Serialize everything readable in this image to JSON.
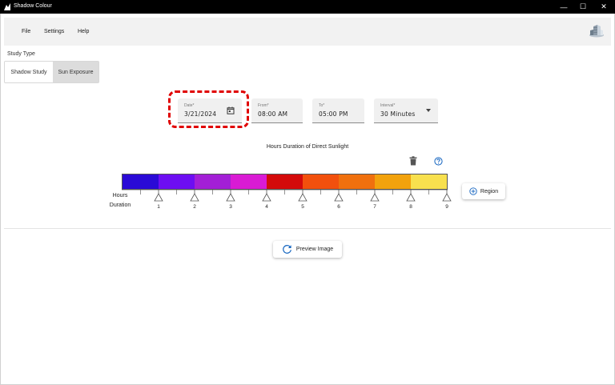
{
  "window": {
    "title": "Shadow Colour",
    "minimize": "—",
    "maximize": "☐",
    "close": "✕"
  },
  "menu": {
    "items": [
      {
        "label": "File"
      },
      {
        "label": "Settings"
      },
      {
        "label": "Help"
      }
    ],
    "logo_icon": "building-logo-icon"
  },
  "study_type": {
    "label": "Study Type",
    "options": [
      {
        "label": "Shadow Study",
        "active": false
      },
      {
        "label": "Sun Exposure",
        "active": true
      }
    ]
  },
  "inputs": {
    "date": {
      "label": "Date*",
      "value": "3/21/2024",
      "icon": "calendar-icon"
    },
    "from": {
      "label": "From*",
      "value": "08:00 AM"
    },
    "to": {
      "label": "To*",
      "value": "05:00 PM"
    },
    "interval": {
      "label": "Interval*",
      "value": "30 Minutes"
    }
  },
  "legend": {
    "title": "Hours Duration of Direct Sunlight",
    "axis_label_line1": "Hours",
    "axis_label_line2": "Duration",
    "colors": [
      "#2a0ad6",
      "#6d0ef2",
      "#a31fd6",
      "#d91bd4",
      "#d40b0b",
      "#f2500d",
      "#f0700e",
      "#f2a20d",
      "#f8e04e"
    ],
    "tick_labels": [
      "1",
      "2",
      "3",
      "4",
      "5",
      "6",
      "7",
      "8",
      "9"
    ],
    "delete_icon": "trash-icon",
    "help_icon": "help-circle-icon"
  },
  "region_button": {
    "label": "Region",
    "icon": "plus-circle-icon"
  },
  "preview_button": {
    "label": "Preview Image",
    "icon": "refresh-icon"
  },
  "accent_color": "#1565c0",
  "highlight_color": "#e00000"
}
